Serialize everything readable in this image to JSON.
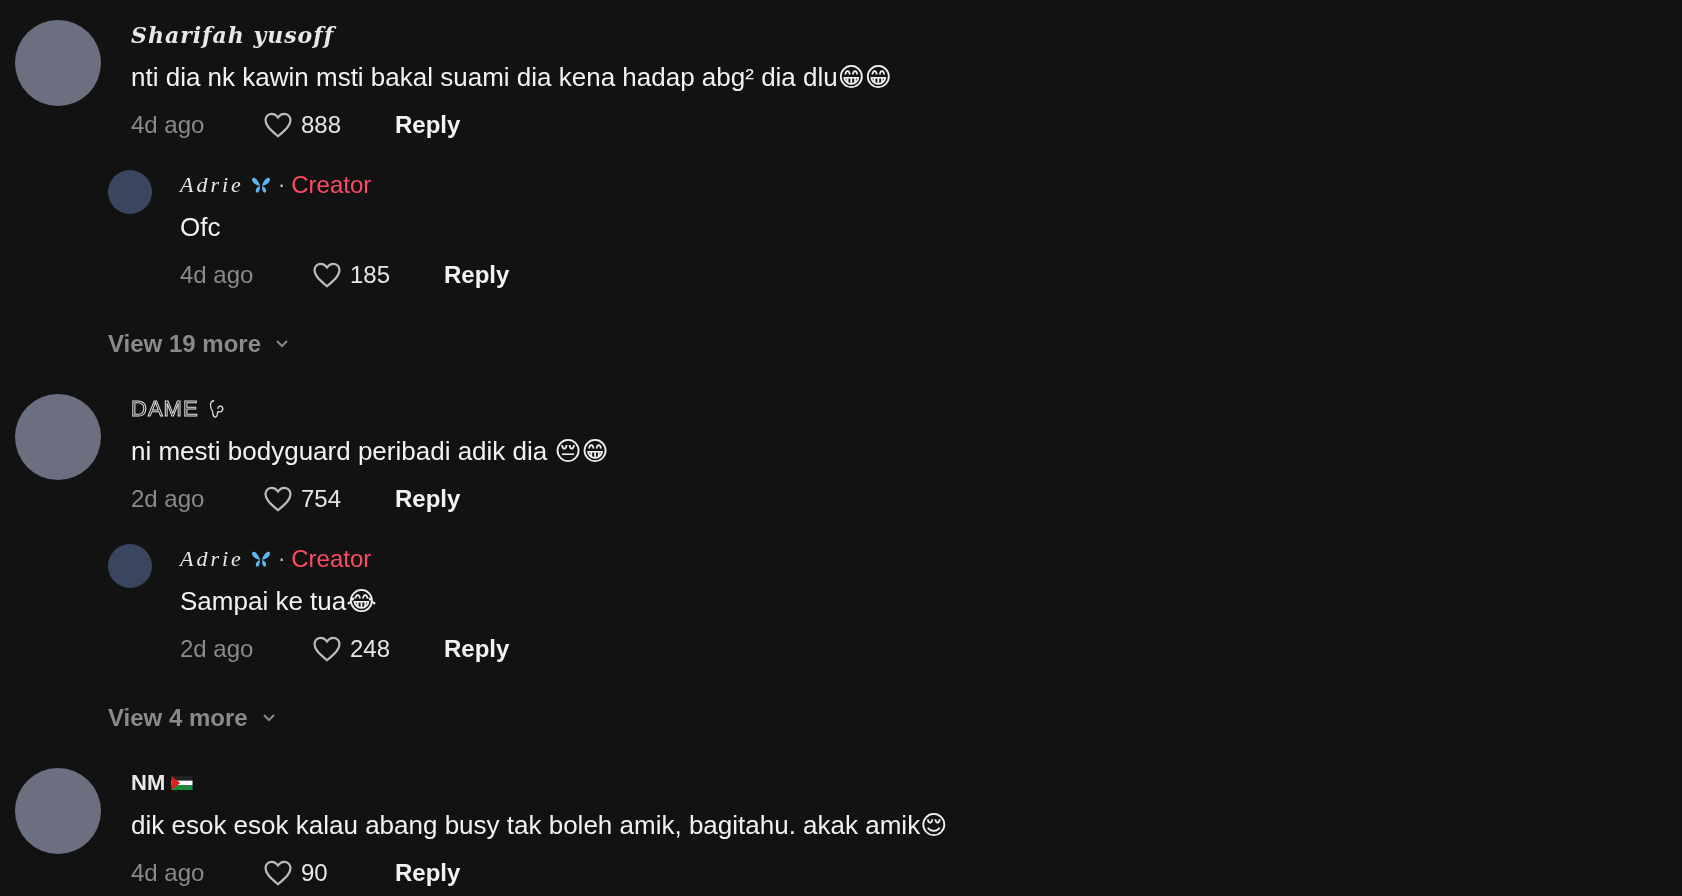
{
  "comments": [
    {
      "kind": "serif",
      "author": "Sharifah yusoff",
      "text": "nti dia nk kawin msti bakal suami dia kena hadap abg² dia dlu😁😁",
      "time": "4d ago",
      "liked": false,
      "likes": "888",
      "reply_label": "Reply",
      "replies": [
        {
          "kind": "script",
          "author": "Adrie",
          "separator": "·",
          "badge": "Creator",
          "text": "Ofc",
          "time": "4d ago",
          "liked": false,
          "likes": "185",
          "reply_label": "Reply"
        }
      ],
      "view_more": "View 19 more"
    },
    {
      "kind": "outline",
      "author": "DAME",
      "text": "ni mesti bodyguard peribadi adik dia 😔😁",
      "time": "2d ago",
      "liked": false,
      "likes": "754",
      "reply_label": "Reply",
      "replies": [
        {
          "kind": "script",
          "author": "Adrie",
          "separator": "·",
          "badge": "Creator",
          "text": "Sampai ke tua😂",
          "time": "2d ago",
          "liked": false,
          "likes": "248",
          "reply_label": "Reply"
        }
      ],
      "view_more": "View 4 more"
    },
    {
      "kind": "plain",
      "author": "NM",
      "text": "dik esok esok kalau abang busy tak boleh amik, bagitahu. akak amik😌",
      "time": "4d ago",
      "liked": false,
      "likes": "90",
      "reply_label": "Reply"
    }
  ]
}
